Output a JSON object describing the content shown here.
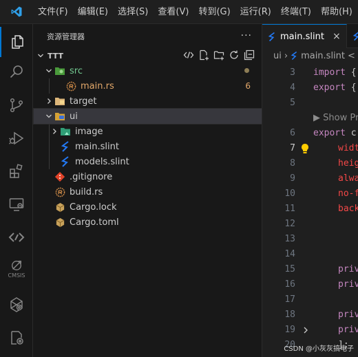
{
  "menu": [
    "文件(F)",
    "编辑(E)",
    "选择(S)",
    "查看(V)",
    "转到(G)",
    "运行(R)",
    "终端(T)",
    "帮助(H)"
  ],
  "activity": {
    "cmsis_caption": "CMSIS"
  },
  "sidebar": {
    "title": "资源管理器",
    "more": "···",
    "section": "TTT",
    "tree": [
      {
        "label": "src",
        "badge": ""
      },
      {
        "label": "main.rs",
        "badge": "6"
      },
      {
        "label": "target",
        "badge": ""
      },
      {
        "label": "ui",
        "badge": ""
      },
      {
        "label": "image",
        "badge": ""
      },
      {
        "label": "main.slint",
        "badge": ""
      },
      {
        "label": "models.slint",
        "badge": ""
      },
      {
        "label": ".gitignore",
        "badge": ""
      },
      {
        "label": "build.rs",
        "badge": ""
      },
      {
        "label": "Cargo.lock",
        "badge": ""
      },
      {
        "label": "Cargo.toml",
        "badge": ""
      }
    ]
  },
  "editor": {
    "tab_active": "main.slint",
    "tab_close": "×",
    "breadcrumb_folder": "ui",
    "breadcrumb_sep": "›",
    "breadcrumb_file": "main.slint",
    "breadcrumb_more": "<",
    "lines": [
      {
        "n": "3",
        "kw": "import",
        "rest": " {"
      },
      {
        "n": "4",
        "kw": "export",
        "rest": " {"
      },
      {
        "n": "5",
        "kw": "",
        "rest": ""
      },
      {
        "n": "",
        "kw": "",
        "rest": "",
        "hint": "▶ Show Pr"
      },
      {
        "n": "6",
        "kw": "export",
        "rest": " c"
      },
      {
        "n": "7",
        "kw": "",
        "prop": "widt",
        "rest": ""
      },
      {
        "n": "8",
        "kw": "",
        "prop": "heig",
        "rest": ""
      },
      {
        "n": "9",
        "kw": "",
        "prop": "alwa",
        "rest": ""
      },
      {
        "n": "10",
        "kw": "",
        "prop": "no-f",
        "rest": ""
      },
      {
        "n": "11",
        "kw": "",
        "prop": "back",
        "rest": ""
      },
      {
        "n": "12",
        "kw": "",
        "rest": ""
      },
      {
        "n": "13",
        "kw": "",
        "rest": ""
      },
      {
        "n": "14",
        "kw": "",
        "rest": ""
      },
      {
        "n": "15",
        "kw": "priv",
        "rest": ""
      },
      {
        "n": "16",
        "kw": "priv",
        "rest": ""
      },
      {
        "n": "17",
        "kw": "",
        "rest": ""
      },
      {
        "n": "18",
        "kw": "priv",
        "rest": ""
      },
      {
        "n": "19",
        "kw": "priv",
        "rest": ""
      },
      {
        "n": "20",
        "kw": "",
        "rest": "];"
      }
    ]
  },
  "watermark": "CSDN @小灰灰搞电子",
  "colors": {
    "accent": "#0078d4",
    "keyword": "#c586c0",
    "property": "#f44747",
    "rust": "#ce8a47",
    "slint": "#2379f4"
  }
}
